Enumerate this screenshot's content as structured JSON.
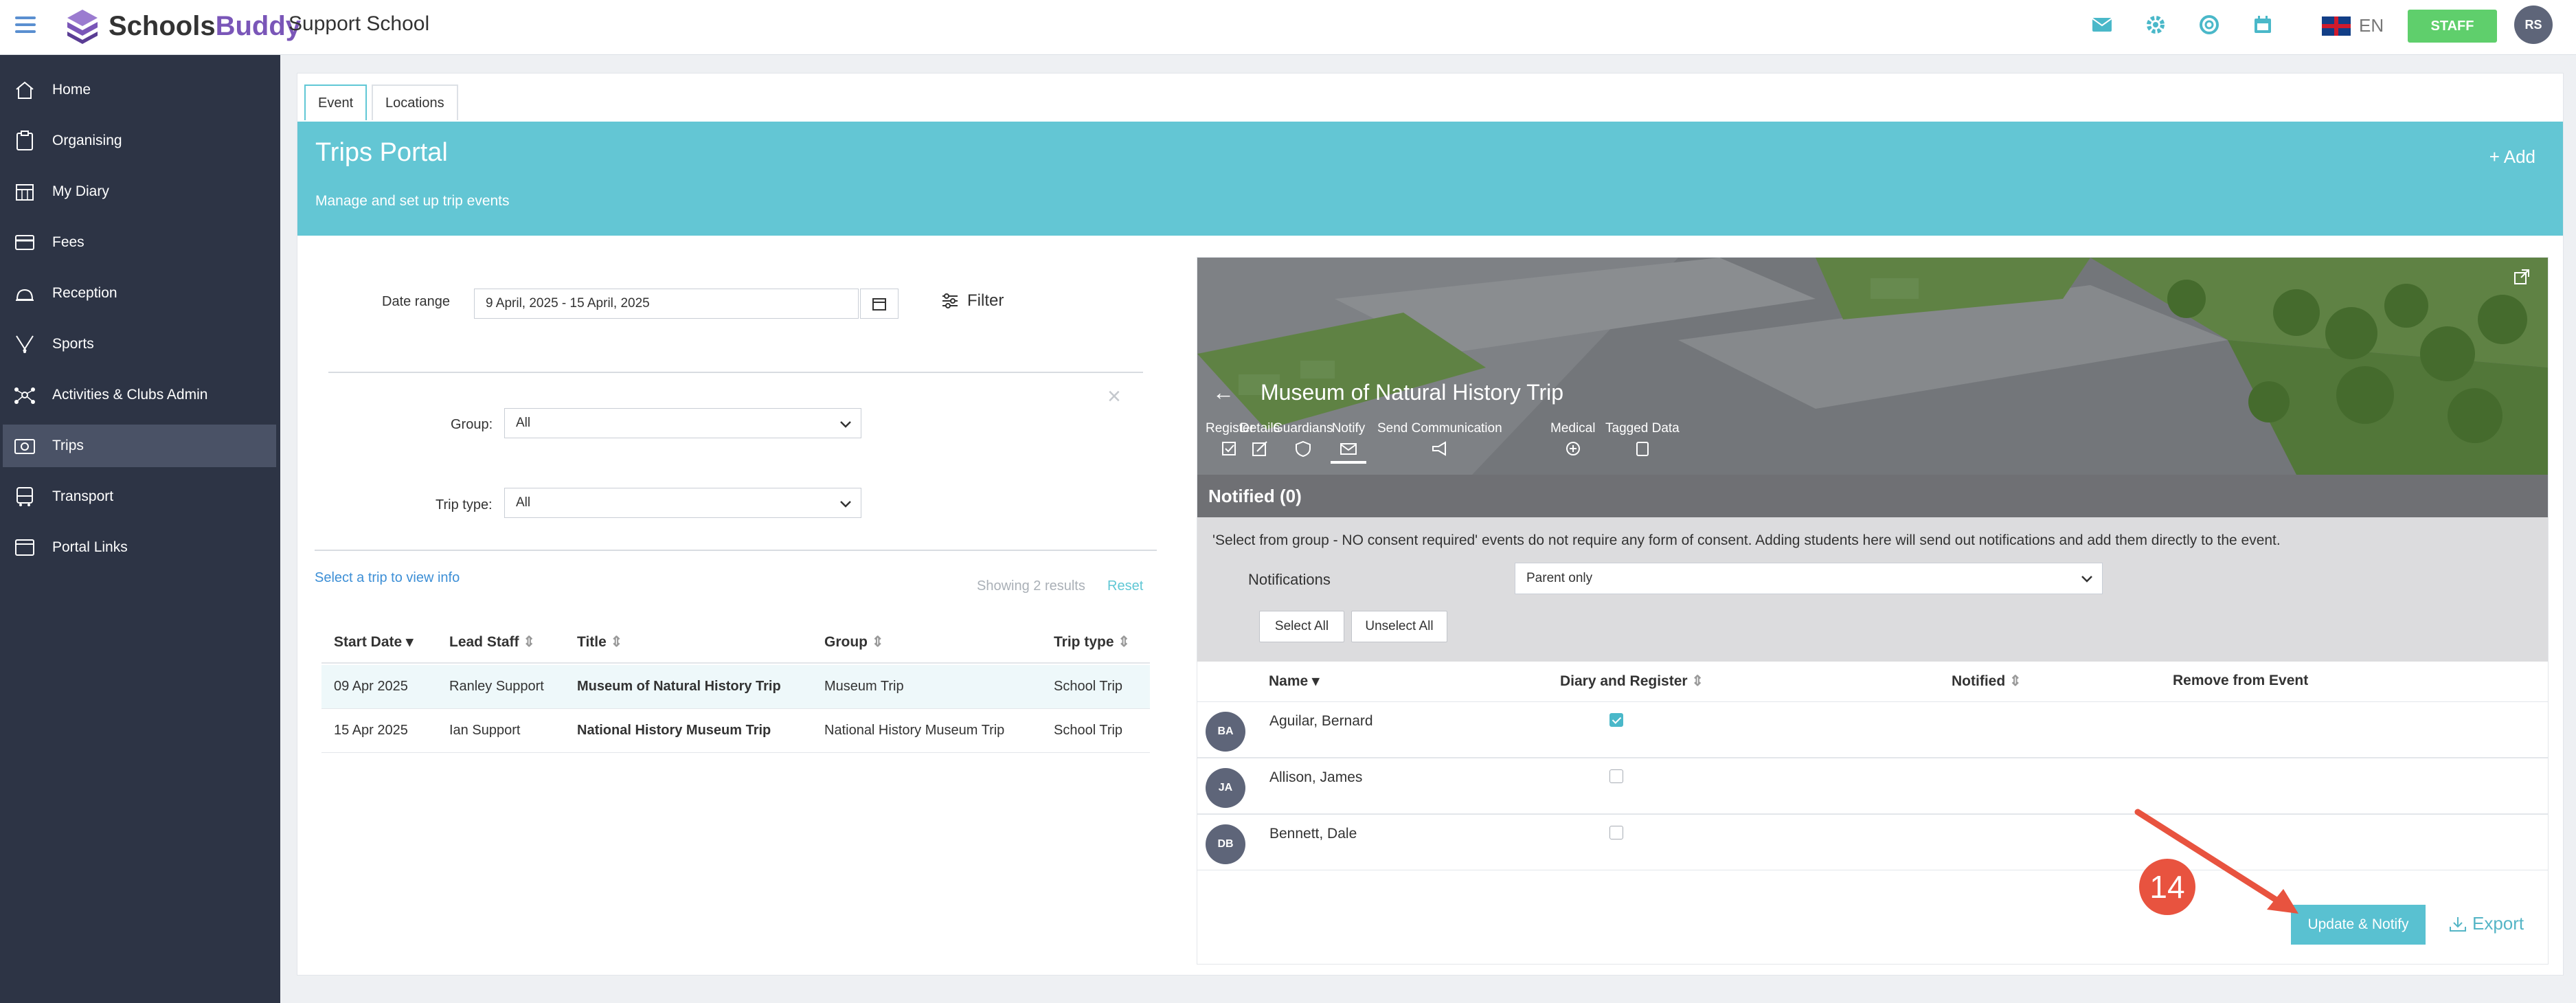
{
  "app": {
    "brand_schools": "Schools",
    "brand_buddy": "Buddy",
    "school_name": "Support School",
    "language": "EN",
    "role_badge": "STAFF",
    "user_initials": "RS"
  },
  "top_icons": [
    "mail-icon",
    "gear-icon",
    "help-icon",
    "calendar-icon"
  ],
  "sidebar": {
    "items": [
      {
        "label": "Home",
        "icon": "home-icon"
      },
      {
        "label": "Organising",
        "icon": "clipboard-icon"
      },
      {
        "label": "My Diary",
        "icon": "calendar-icon"
      },
      {
        "label": "Fees",
        "icon": "card-icon"
      },
      {
        "label": "Reception",
        "icon": "bell-icon"
      },
      {
        "label": "Sports",
        "icon": "sports-icon"
      },
      {
        "label": "Activities & Clubs Admin",
        "icon": "network-icon"
      },
      {
        "label": "Trips",
        "icon": "trips-icon"
      },
      {
        "label": "Transport",
        "icon": "bus-icon"
      },
      {
        "label": "Portal Links",
        "icon": "link-icon"
      }
    ],
    "active": "Trips"
  },
  "tabs": [
    "Event",
    "Locations"
  ],
  "banner": {
    "title": "Trips Portal",
    "subtitle": "Manage and set up trip events",
    "add_label": "+ Add"
  },
  "filters": {
    "date_range_label": "Date range",
    "date_range_value": "9 April, 2025 - 15 April, 2025",
    "filter_label": "Filter",
    "group_label": "Group:",
    "group_value": "All",
    "trip_type_label": "Trip type:",
    "trip_type_value": "All"
  },
  "list": {
    "info_link": "Select a trip to view info",
    "showing": "Showing 2 results",
    "reset": "Reset",
    "columns": [
      "Start Date",
      "Lead Staff",
      "Title",
      "Group",
      "Trip type"
    ],
    "rows": [
      {
        "start_date": "09 Apr 2025",
        "lead_staff": "Ranley Support",
        "title": "Museum of Natural History Trip",
        "group": "Museum Trip",
        "trip_type": "School Trip"
      },
      {
        "start_date": "15 Apr 2025",
        "lead_staff": "Ian Support",
        "title": "National History Museum Trip",
        "group": "National History Museum Trip",
        "trip_type": "School Trip"
      }
    ]
  },
  "panel": {
    "trip_title": "Museum of Natural History Trip",
    "tabs": [
      "Register",
      "Details",
      "Guardians",
      "Notify",
      "Send Communication",
      "Medical",
      "Tagged Data"
    ],
    "active_tab": "Notify",
    "notified_header": "Notified (0)",
    "info_text": "'Select from group - NO consent required' events do not require any form of consent. Adding students here will send out notifications and add them directly to the event.",
    "notifications_label": "Notifications",
    "notifications_value": "Parent only",
    "select_all": "Select All",
    "unselect_all": "Unselect All",
    "columns": [
      "Name",
      "Diary and Register",
      "Notified",
      "Remove from Event"
    ],
    "students": [
      {
        "initials": "BA",
        "name": "Aguilar, Bernard",
        "diary_register": true
      },
      {
        "initials": "JA",
        "name": "Allison, James",
        "diary_register": false
      },
      {
        "initials": "DB",
        "name": "Bennett, Dale",
        "diary_register": false
      }
    ],
    "update_button": "Update & Notify",
    "export_label": "Export"
  },
  "annotation": {
    "step": "14",
    "color": "#e8533f"
  }
}
